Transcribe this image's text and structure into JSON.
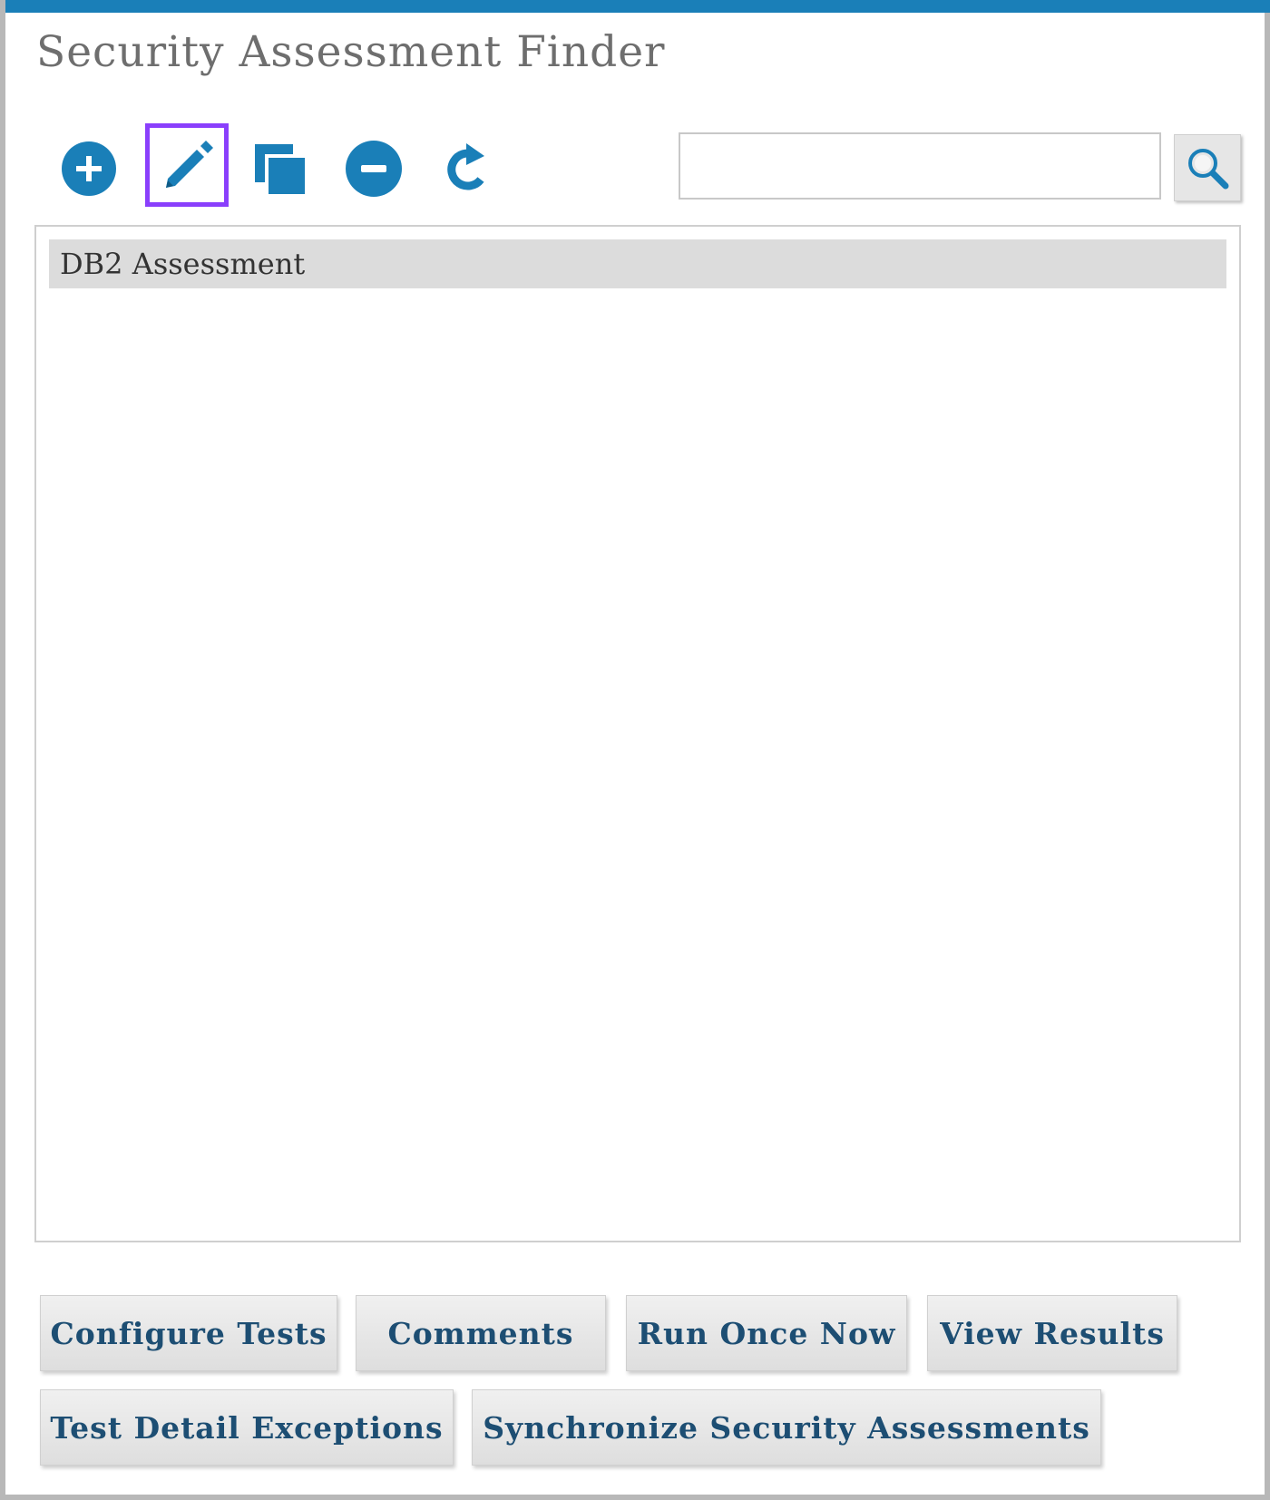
{
  "window": {
    "title": "Security Assessment Finder",
    "accent_color": "#1a7fb8",
    "selection_color": "#8a3ffc"
  },
  "toolbar": {
    "buttons": [
      {
        "icon": "add-icon",
        "label": "Add"
      },
      {
        "icon": "edit-icon",
        "label": "Edit",
        "selected": true
      },
      {
        "icon": "copy-icon",
        "label": "Copy"
      },
      {
        "icon": "remove-icon",
        "label": "Remove"
      },
      {
        "icon": "refresh-icon",
        "label": "Refresh"
      }
    ]
  },
  "search": {
    "value": "",
    "placeholder": "",
    "button_icon": "search-icon"
  },
  "list": {
    "items": [
      {
        "label": "DB2 Assessment"
      }
    ]
  },
  "actions": {
    "configure_tests": "Configure Tests",
    "comments": "Comments",
    "run_once_now": "Run Once Now",
    "view_results": "View Results",
    "test_detail_exceptions": "Test Detail Exceptions",
    "synchronize_security_assessments": "Synchronize Security Assessments"
  }
}
